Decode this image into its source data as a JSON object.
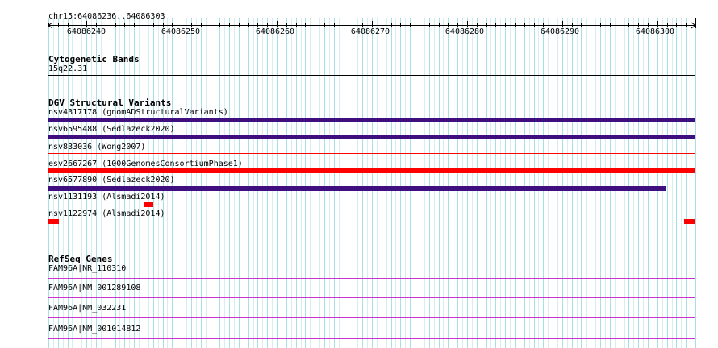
{
  "ruler": {
    "coordinates": "chr15:64086236..64086303",
    "start": 64086236,
    "end": 64086303,
    "ticks": [
      "64086240",
      "64086250",
      "64086260",
      "64086270",
      "64086280",
      "64086290",
      "64086300"
    ]
  },
  "cytogenetic_bands": {
    "title": "Cytogenetic Bands",
    "band": "15q22.31"
  },
  "dgv": {
    "title": "DGV Structural Variants",
    "variants": [
      {
        "label": "nsv4317178 (gnomADStructuralVariants)",
        "color": "#3f0f7f"
      },
      {
        "label": "nsv6595488 (Sedlazeck2020)",
        "color": "#3f0f7f"
      },
      {
        "label": "nsv833036 (Wong2007)",
        "color": "#ff0000"
      },
      {
        "label": "esv2667267 (1000GenomesConsortiumPhase1)",
        "color": "#ff0000"
      },
      {
        "label": "nsv6577890 (Sedlazeck2020)",
        "color": "#3f0f7f"
      },
      {
        "label": "nsv1131193 (Alsmadi2014)",
        "color": "#ff0000"
      },
      {
        "label": "nsv1122974 (Alsmadi2014)",
        "color": "#ff0000"
      }
    ]
  },
  "refseq": {
    "title": "RefSeq Genes",
    "genes": [
      {
        "label": "FAM96A|NR_110310",
        "color": "#cc33cc"
      },
      {
        "label": "FAM96A|NM_001289108",
        "color": "#cc33cc"
      },
      {
        "label": "FAM96A|NM_032231",
        "color": "#cc33cc"
      },
      {
        "label": "FAM96A|NM_001014812",
        "color": "#cc33cc"
      }
    ]
  }
}
